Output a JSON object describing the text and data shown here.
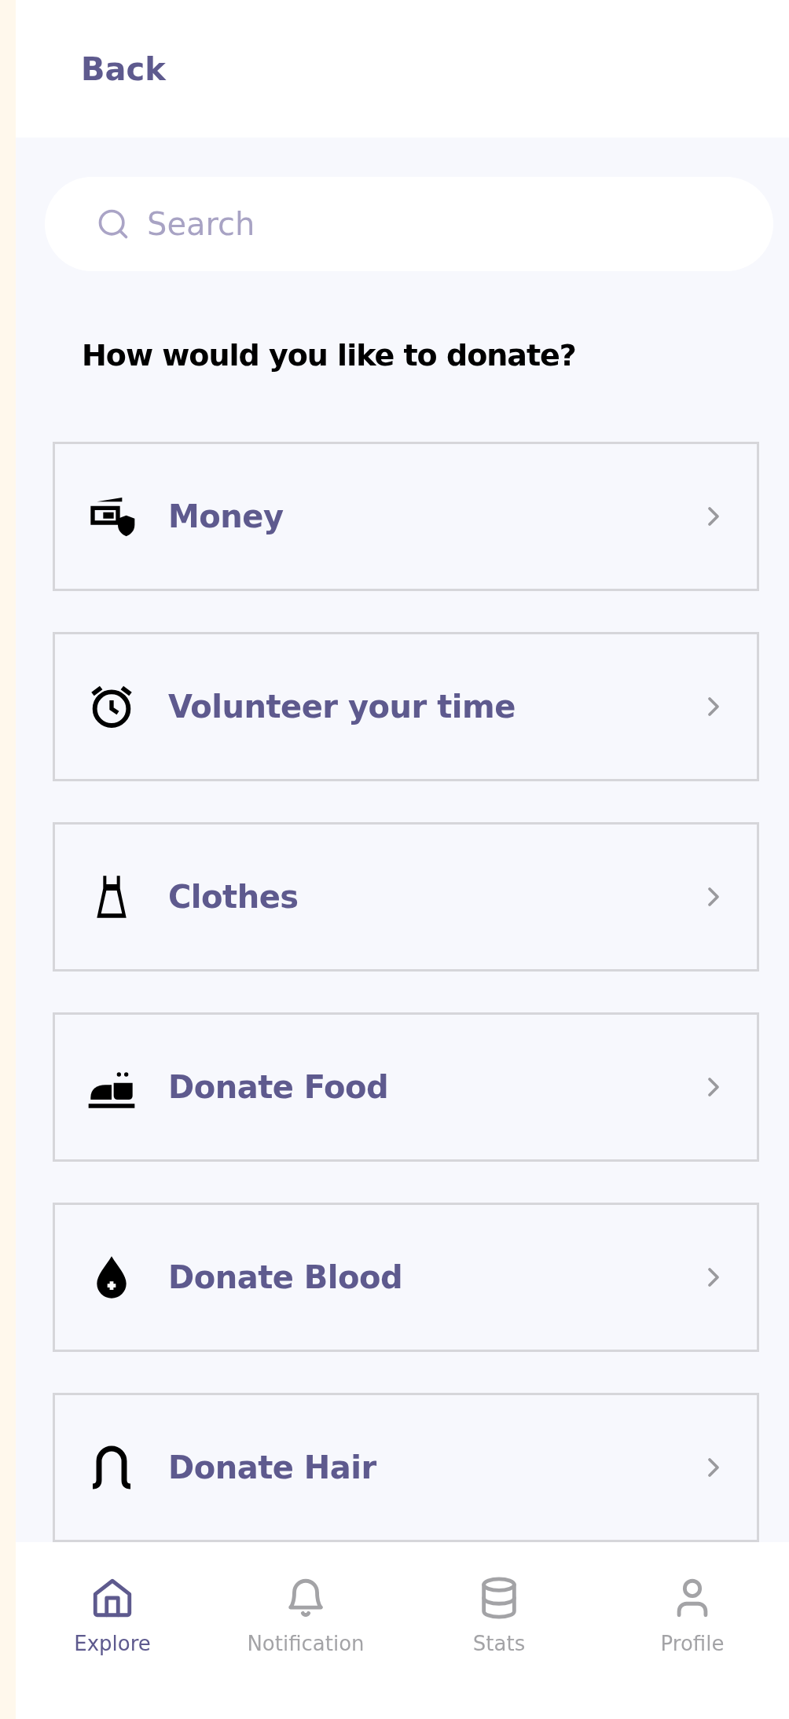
{
  "header": {
    "back": "Back"
  },
  "search": {
    "placeholder": "Search"
  },
  "heading": "How would you like to donate?",
  "options": [
    {
      "kind": "money",
      "label": "Money"
    },
    {
      "kind": "time",
      "label": "Volunteer your time"
    },
    {
      "kind": "clothes",
      "label": "Clothes"
    },
    {
      "kind": "food",
      "label": "Donate Food"
    },
    {
      "kind": "blood",
      "label": "Donate Blood"
    },
    {
      "kind": "hair",
      "label": "Donate Hair"
    }
  ],
  "nav": [
    {
      "kind": "home",
      "label": "Explore",
      "selected": true
    },
    {
      "kind": "bell",
      "label": "Notification",
      "selected": false
    },
    {
      "kind": "stats",
      "label": "Stats",
      "selected": false
    },
    {
      "kind": "profile",
      "label": "Profile",
      "selected": false
    }
  ]
}
